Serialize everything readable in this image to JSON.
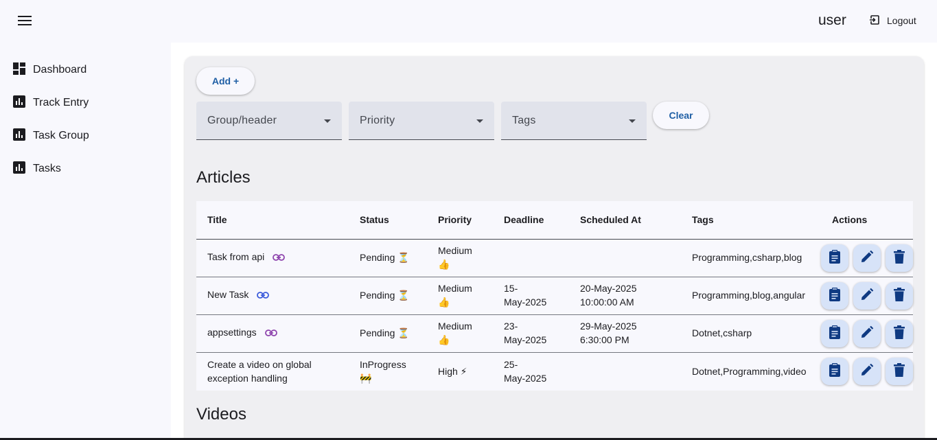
{
  "header": {
    "username": "user",
    "logout_label": "Logout"
  },
  "sidebar": {
    "items": [
      {
        "label": "Dashboard",
        "icon": "dashboard-icon"
      },
      {
        "label": "Track Entry",
        "icon": "bar-chart-icon"
      },
      {
        "label": "Task Group",
        "icon": "bar-chart-icon"
      },
      {
        "label": "Tasks",
        "icon": "bar-chart-icon"
      }
    ]
  },
  "toolbar": {
    "add_label": "Add +",
    "clear_label": "Clear",
    "filters": [
      {
        "placeholder": "Group/header"
      },
      {
        "placeholder": "Priority"
      },
      {
        "placeholder": "Tags"
      }
    ]
  },
  "articles": {
    "title": "Articles",
    "columns": [
      "Title",
      "Status",
      "Priority",
      "Deadline",
      "Scheduled At",
      "Tags",
      "Actions"
    ],
    "rows": [
      {
        "title": "Task from api",
        "has_link": true,
        "status": "Pending ⏳",
        "priority_1": "Medium",
        "priority_2": "👍",
        "deadline_1": "",
        "deadline_2": "",
        "scheduled_1": "",
        "scheduled_2": "",
        "tags": "Programming,csharp,blog"
      },
      {
        "title": "New Task",
        "has_link": true,
        "status": "Pending ⏳",
        "priority_1": "Medium",
        "priority_2": "👍",
        "deadline_1": "15-",
        "deadline_2": "May-2025",
        "scheduled_1": "20-May-2025",
        "scheduled_2": "10:00:00 AM",
        "tags": "Programming,blog,angular"
      },
      {
        "title": "appsettings",
        "has_link": true,
        "status": "Pending ⏳",
        "priority_1": "Medium",
        "priority_2": "👍",
        "deadline_1": "23-",
        "deadline_2": "May-2025",
        "scheduled_1": "29-May-2025",
        "scheduled_2": "6:30:00 PM",
        "tags": "Dotnet,csharp"
      },
      {
        "title_1": "Create a video on global",
        "title_2": "exception handling",
        "status_1": "InProgress",
        "status_2": "🚧",
        "priority": "High ⚡",
        "deadline_1": "25-",
        "deadline_2": "May-2025",
        "scheduled_1": "",
        "scheduled_2": "",
        "tags": "Dotnet,Programming,video"
      }
    ]
  },
  "videos": {
    "title": "Videos"
  },
  "colors": {
    "accent": "#1f5fa5",
    "action_bg": "#d7e3f8",
    "action_icon": "#0f3a82",
    "link_icon_1": "#8e44ad",
    "link_icon_2": "#3b5bdb"
  }
}
